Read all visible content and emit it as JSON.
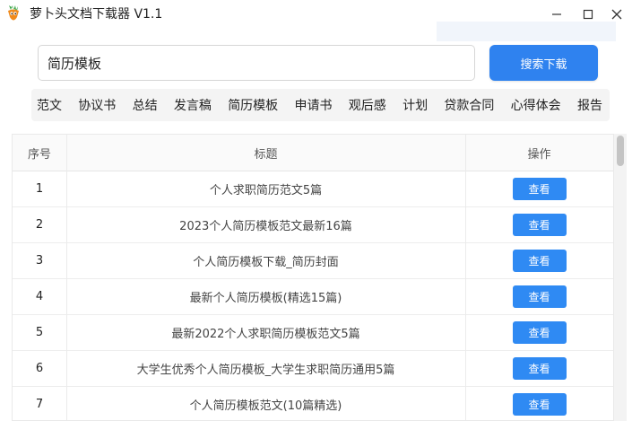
{
  "window": {
    "title": "萝卜头文档下载器 V1.1",
    "minimize_label": "—",
    "maximize_label": "☐",
    "close_label": "✕"
  },
  "search": {
    "value": "简历模板",
    "button_label": "搜索下载"
  },
  "categories": [
    "范文",
    "协议书",
    "总结",
    "发言稿",
    "简历模板",
    "申请书",
    "观后感",
    "计划",
    "贷款合同",
    "心得体会",
    "报告"
  ],
  "table": {
    "headers": {
      "index": "序号",
      "title": "标题",
      "action": "操作"
    },
    "rows": [
      {
        "index": "1",
        "title": "个人求职简历范文5篇",
        "action": "查看"
      },
      {
        "index": "2",
        "title": "2023个人简历模板范文最新16篇",
        "action": "查看"
      },
      {
        "index": "3",
        "title": "个人简历模板下载_简历封面",
        "action": "查看"
      },
      {
        "index": "4",
        "title": "最新个人简历模板(精选15篇)",
        "action": "查看"
      },
      {
        "index": "5",
        "title": "最新2022个人求职简历模板范文5篇",
        "action": "查看"
      },
      {
        "index": "6",
        "title": "大学生优秀个人简历模板_大学生求职简历通用5篇",
        "action": "查看"
      },
      {
        "index": "7",
        "title": "个人简历模板范文(10篇精选)",
        "action": "查看"
      }
    ]
  },
  "colors": {
    "primary_button": "#2f82ef",
    "view_button": "#2f8af3",
    "category_bar": "#f4f4f4",
    "icon_orange": "#f08a1c",
    "icon_green": "#3aa648"
  },
  "icons": {
    "app": "carrot-logo-icon",
    "minimize": "minimize-icon",
    "maximize": "maximize-icon",
    "close": "close-icon"
  }
}
